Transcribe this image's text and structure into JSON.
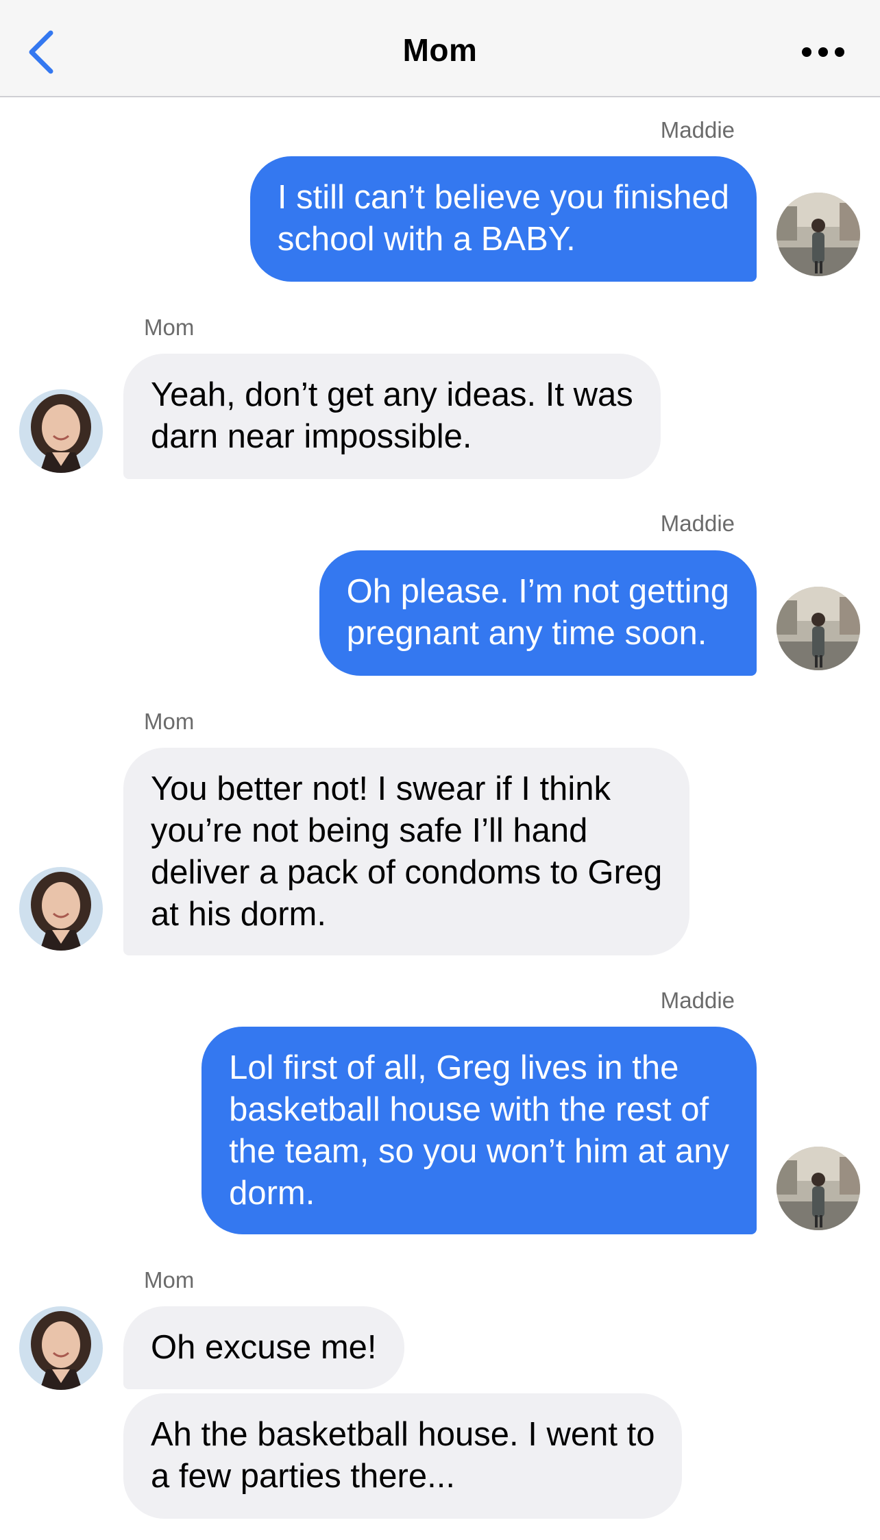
{
  "header": {
    "title": "Mom",
    "back_icon": "chevron-left-icon",
    "more_icon": "ellipsis-icon",
    "accent": "#3478f0"
  },
  "colors": {
    "outgoing_bubble": "#3478f0",
    "incoming_bubble": "#f0f0f3",
    "sender_label": "#6b6b6b"
  },
  "messages": [
    {
      "sender": "Maddie",
      "direction": "outgoing",
      "text": "I still can’t believe you finished\nschool with a BABY."
    },
    {
      "sender": "Mom",
      "direction": "incoming",
      "text": "Yeah, don’t get any ideas. It was\ndarn near impossible."
    },
    {
      "sender": "Maddie",
      "direction": "outgoing",
      "text": "Oh please. I’m not getting\npregnant any time soon."
    },
    {
      "sender": "Mom",
      "direction": "incoming",
      "text": "You better not! I swear if I think\nyou’re not being safe I’ll hand\ndeliver a pack of condoms to Greg\nat his dorm."
    },
    {
      "sender": "Maddie",
      "direction": "outgoing",
      "text": "Lol first of all, Greg lives in the\nbasketball house with the rest of\nthe team, so you won’t him at any\ndorm."
    },
    {
      "sender": "Mom",
      "direction": "incoming",
      "text": "Oh excuse me!"
    },
    {
      "sender": "Mom",
      "direction": "incoming",
      "text": "Ah the basketball house. I went to\na few parties there..."
    }
  ]
}
